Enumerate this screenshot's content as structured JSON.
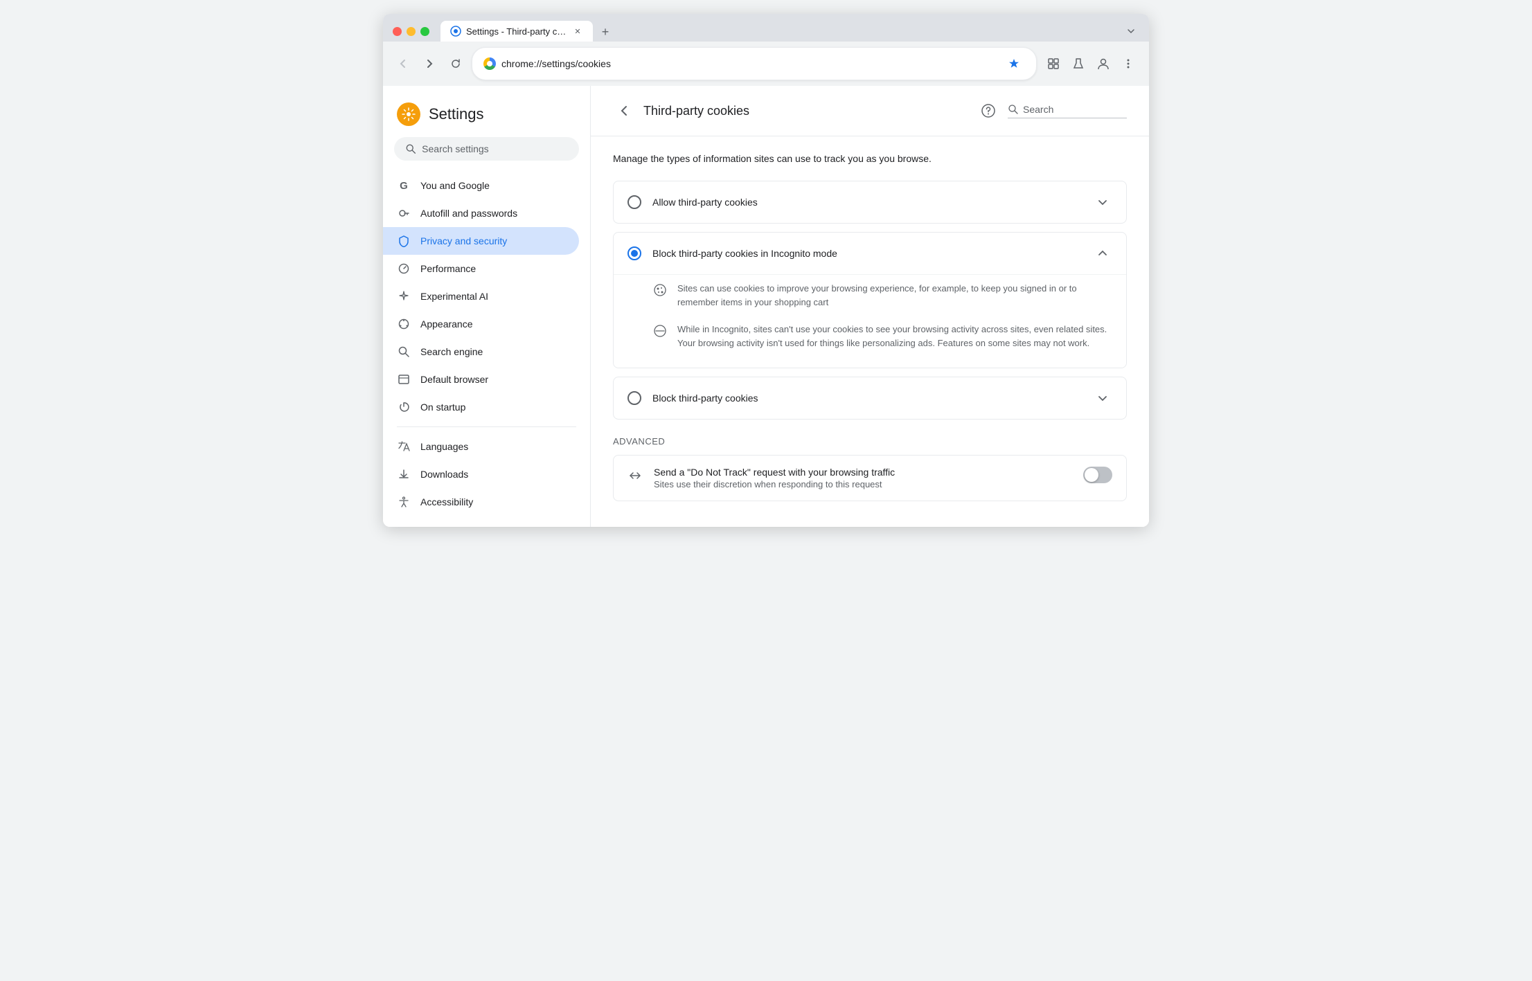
{
  "browser": {
    "tab_title": "Settings - Third-party cookie",
    "url": "chrome://settings/cookies",
    "chrome_label": "Chrome"
  },
  "header": {
    "settings_title": "Settings",
    "search_placeholder": "Search settings"
  },
  "sidebar": {
    "items": [
      {
        "id": "you-and-google",
        "label": "You and Google",
        "icon": "G"
      },
      {
        "id": "autofill",
        "label": "Autofill and passwords",
        "icon": "key"
      },
      {
        "id": "privacy",
        "label": "Privacy and security",
        "icon": "shield",
        "active": true
      },
      {
        "id": "performance",
        "label": "Performance",
        "icon": "gauge"
      },
      {
        "id": "experimental-ai",
        "label": "Experimental AI",
        "icon": "star"
      },
      {
        "id": "appearance",
        "label": "Appearance",
        "icon": "palette"
      },
      {
        "id": "search-engine",
        "label": "Search engine",
        "icon": "search"
      },
      {
        "id": "default-browser",
        "label": "Default browser",
        "icon": "browser"
      },
      {
        "id": "on-startup",
        "label": "On startup",
        "icon": "power"
      }
    ],
    "items2": [
      {
        "id": "languages",
        "label": "Languages",
        "icon": "translate"
      },
      {
        "id": "downloads",
        "label": "Downloads",
        "icon": "download"
      },
      {
        "id": "accessibility",
        "label": "Accessibility",
        "icon": "accessibility"
      }
    ]
  },
  "content": {
    "page_title": "Third-party cookies",
    "search_placeholder": "Search",
    "description": "Manage the types of information sites can use to track you as you browse.",
    "options": [
      {
        "id": "allow",
        "label": "Allow third-party cookies",
        "selected": false,
        "expanded": false
      },
      {
        "id": "block-incognito",
        "label": "Block third-party cookies in Incognito mode",
        "selected": true,
        "expanded": true,
        "details": [
          {
            "icon": "cookie",
            "text": "Sites can use cookies to improve your browsing experience, for example, to keep you signed in or to remember items in your shopping cart"
          },
          {
            "icon": "block",
            "text": "While in Incognito, sites can't use your cookies to see your browsing activity across sites, even related sites. Your browsing activity isn't used for things like personalizing ads. Features on some sites may not work."
          }
        ]
      },
      {
        "id": "block",
        "label": "Block third-party cookies",
        "selected": false,
        "expanded": false
      }
    ],
    "advanced": {
      "label": "Advanced",
      "rows": [
        {
          "id": "do-not-track",
          "icon": "arrows",
          "title": "Send a \"Do Not Track\" request with your browsing traffic",
          "subtitle": "Sites use their discretion when responding to this request",
          "toggle": false
        }
      ]
    }
  }
}
